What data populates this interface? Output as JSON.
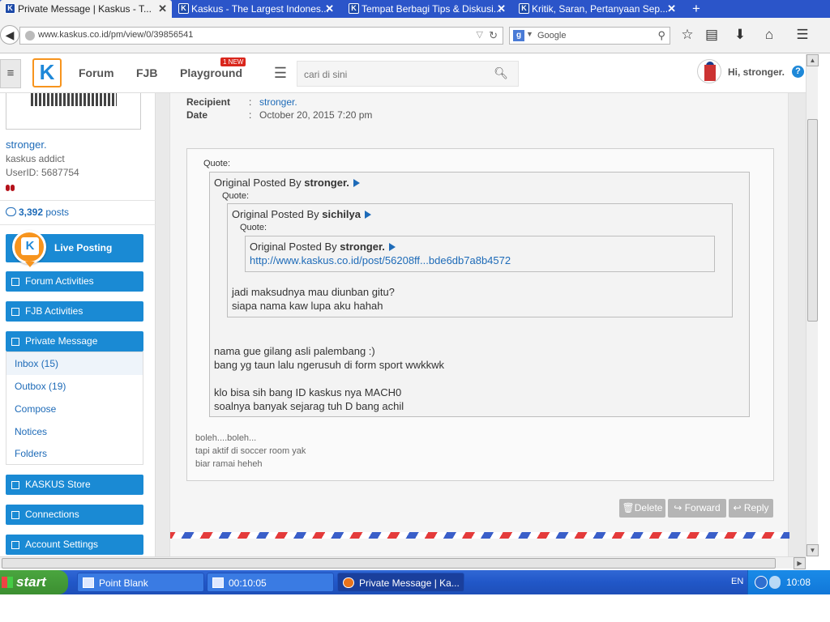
{
  "browser": {
    "tabs": [
      {
        "title": "Private Message | Kaskus - T...",
        "active": true
      },
      {
        "title": "Kaskus - The Largest Indones...",
        "active": false
      },
      {
        "title": "Tempat Berbagi Tips & Diskusi...",
        "active": false
      },
      {
        "title": "Kritik, Saran, Pertanyaan Sep...",
        "active": false
      }
    ],
    "new_tab": "+",
    "url": "www.kaskus.co.id/pm/view/0/39856541",
    "search_engine": "Google"
  },
  "header": {
    "nav": [
      "Forum",
      "FJB",
      "Playground"
    ],
    "badge": "1 NEW",
    "search_placeholder": "cari di sini",
    "greeting": "Hi, stronger."
  },
  "sidebar": {
    "username": "stronger.",
    "rank": "kaskus addict",
    "user_id": "UserID: 5687754",
    "posts_count": "3,392",
    "posts_label": "posts",
    "live_posting": "Live Posting",
    "forum_activities": "Forum Activities",
    "fjb_activities": "FJB Activities",
    "private_message": "Private Message",
    "pm_items": [
      "Inbox (15)",
      "Outbox (19)",
      "Compose",
      "Notices",
      "Folders"
    ],
    "kaskus_store": "KASKUS Store",
    "connections": "Connections",
    "account_settings": "Account Settings"
  },
  "message": {
    "recipient_label": "Recipient",
    "recipient": "stronger.",
    "date_label": "Date",
    "date": "October 20, 2015 7:20 pm",
    "colon": ":",
    "quote_label": "Quote:",
    "posted_by": "Original Posted By",
    "q1_author": "stronger.",
    "q2_author": "sichilya",
    "q3_author": "stronger.",
    "q3_link": "http://www.kaskus.co.id/post/56208ff...bde6db7a8b4572",
    "q2_body": [
      "jadi maksudnya mau diunban gitu?",
      "siapa nama kaw lupa aku hahah"
    ],
    "q1_body": [
      "nama gue gilang asli palembang :)",
      "bang yg taun lalu ngerusuh di form sport wwkkwk",
      "",
      "klo bisa sih bang ID kaskus nya MACH0",
      "soalnya banyak sejarag tuh D bang achil"
    ],
    "reply": [
      "boleh....boleh...",
      "tapi aktif di soccer room yak",
      "biar ramai heheh"
    ]
  },
  "actions": {
    "delete": "Delete",
    "forward": "Forward",
    "reply": "Reply"
  },
  "taskbar": {
    "start": "start",
    "tasks": [
      "Point Blank",
      "00:10:05",
      "Private Message | Ka..."
    ],
    "language": "EN",
    "clock": "10:08"
  }
}
